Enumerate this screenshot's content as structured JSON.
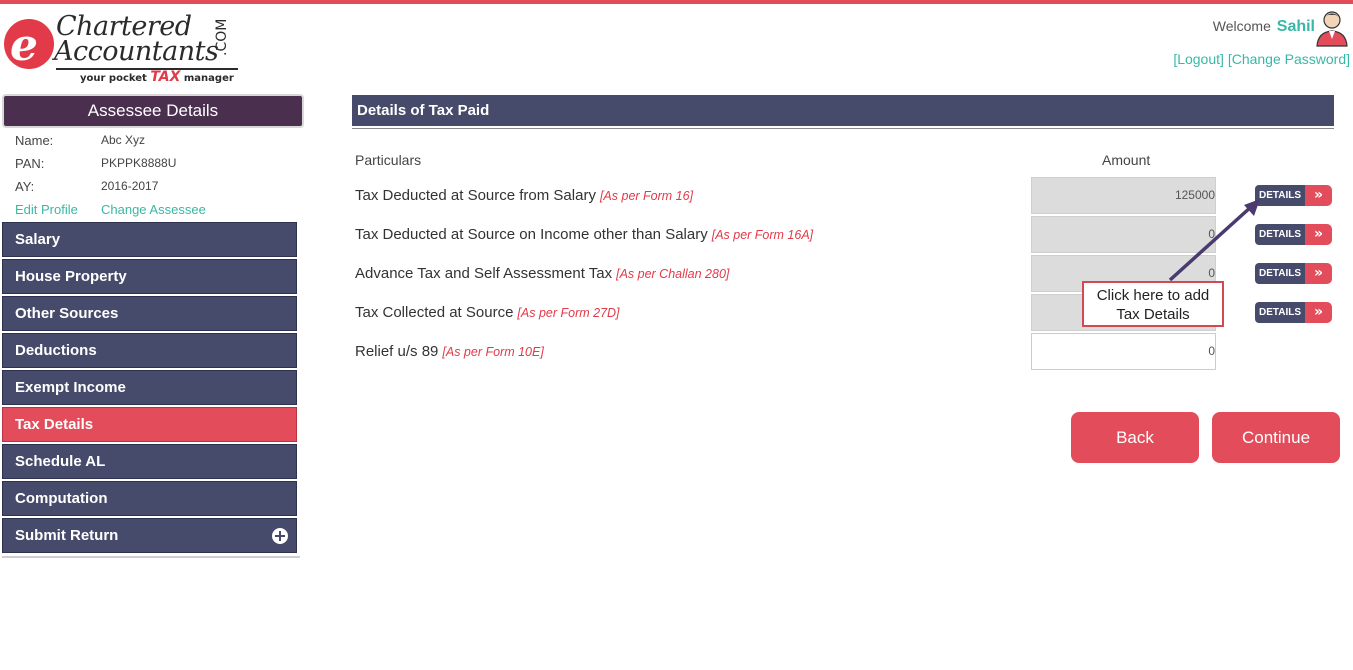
{
  "logo": {
    "letter": "e",
    "line1": "Chartered",
    "line2": "Accountants",
    "com": ".COM",
    "tagline_pre": "your pocket",
    "tagline_tax": "TAX",
    "tagline_post": "manager"
  },
  "header": {
    "welcome_label": "Welcome",
    "user_name": "Sahil",
    "logout_label": "[Logout]",
    "change_password_label": "[Change Password]"
  },
  "sidebar": {
    "title": "Assessee Details",
    "name_label": "Name:",
    "name_value": "Abc Xyz",
    "pan_label": "PAN:",
    "pan_value": "PKPPK8888U",
    "ay_label": "AY:",
    "ay_value": "2016-2017",
    "edit_profile": "Edit Profile",
    "change_assessee": "Change Assessee",
    "nav": [
      "Salary",
      "House Property",
      "Other Sources",
      "Deductions",
      "Exempt Income",
      "Tax Details",
      "Schedule AL",
      "Computation",
      "Submit Return"
    ],
    "active_index": 5
  },
  "main": {
    "section_title": "Details of Tax Paid",
    "col_particulars": "Particulars",
    "col_amount": "Amount",
    "rows": [
      {
        "label": "Tax Deducted at Source from Salary",
        "ref": "[As per Form 16]",
        "amount": "125000",
        "has_details": true
      },
      {
        "label": "Tax Deducted at Source on Income other than Salary",
        "ref": "[As per Form 16A]",
        "amount": "0",
        "has_details": true
      },
      {
        "label": "Advance Tax and Self Assessment Tax",
        "ref": "[As per Challan 280]",
        "amount": "0",
        "has_details": true
      },
      {
        "label": "Tax Collected at Source",
        "ref": "[As per Form 27D]",
        "amount": "",
        "has_details": true
      },
      {
        "label": "Relief u/s 89",
        "ref": "[As per Form 10E]",
        "amount": "0",
        "has_details": false
      }
    ],
    "details_label": "DETAILS",
    "details_arrow": "»",
    "callout_text": "Click here to add Tax Details",
    "back_label": "Back",
    "continue_label": "Continue"
  },
  "colors": {
    "accent": "#e34d5b",
    "nav_bg": "#474b6b",
    "link": "#3ab7a6",
    "assessee_header": "#4a2f4f"
  }
}
